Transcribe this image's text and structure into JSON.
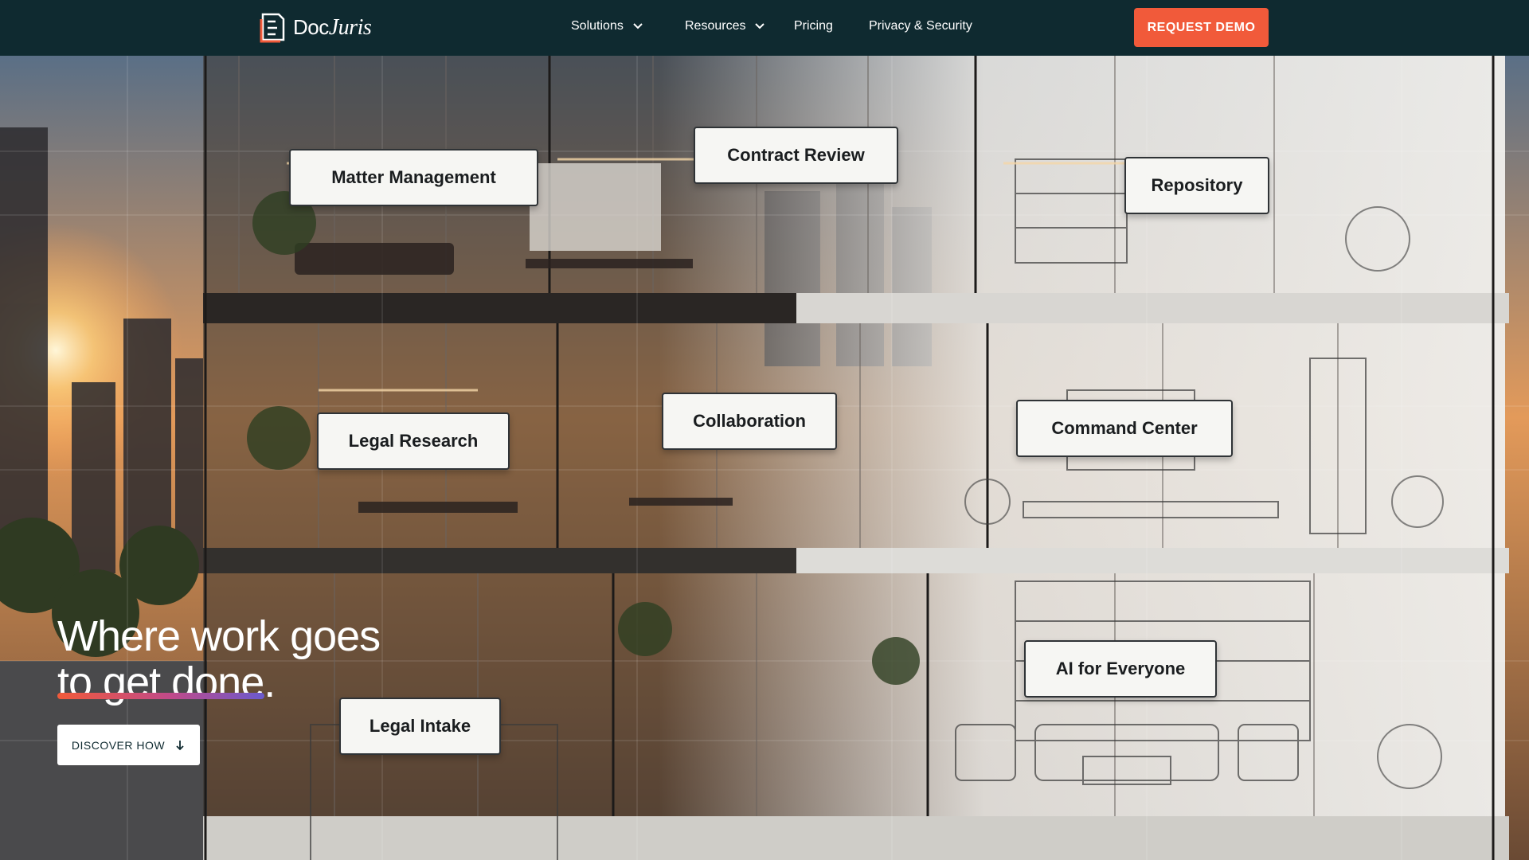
{
  "brand": {
    "name_left": "Doc",
    "name_right": "Juris"
  },
  "nav": {
    "solutions": "Solutions",
    "resources": "Resources",
    "pricing": "Pricing",
    "privacy": "Privacy & Security",
    "cta": "REQUEST DEMO"
  },
  "hero": {
    "headline_line1": "Where work goes",
    "headline_line2": "to get done.",
    "discover": "DISCOVER HOW",
    "labels": {
      "matter": "Matter Management",
      "contract": "Contract Review",
      "repository": "Repository",
      "research": "Legal Research",
      "collaboration": "Collaboration",
      "command": "Command Center",
      "intake": "Legal Intake",
      "ai": "AI for Everyone"
    }
  },
  "colors": {
    "nav_bg": "#0f2a30",
    "accent": "#f15a3a",
    "label_bg": "#f6f6f3"
  },
  "icons": {
    "logo": "document-logo-icon",
    "chevron": "chevron-down-icon",
    "arrow": "arrow-down-icon"
  }
}
